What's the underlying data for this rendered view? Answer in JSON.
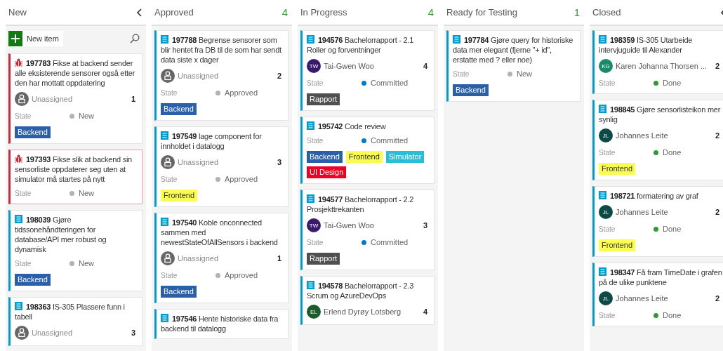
{
  "columns": [
    {
      "title": "New",
      "collapsible": true,
      "new_item": {
        "label": "New item"
      },
      "cards": [
        {
          "kind": "bug",
          "id": "197783",
          "title": "Fikse at backend sender alle eksisterende sensorer også etter den har mottatt oppdatering",
          "selected": false,
          "assignee": {
            "kind": "unassigned",
            "name": "Unassigned"
          },
          "effort": "1",
          "state_label": "State",
          "state": {
            "name": "New",
            "color": "#b2b2b2"
          },
          "tags": [
            {
              "label": "Backend",
              "color": "#2b5fa8"
            }
          ]
        },
        {
          "kind": "bug",
          "id": "197393",
          "title": "Fikse slik at backend sin sensorliste oppdaterer seg uten at simulator må startes på nytt",
          "selected": true,
          "state_label": "State",
          "state": {
            "name": "New",
            "color": "#b2b2b2"
          }
        },
        {
          "kind": "story",
          "id": "198039",
          "title": "Gjøre tidssonehåndteringen for database/API mer robust og dynamisk",
          "selected": false,
          "state_label": "State",
          "state": {
            "name": "New",
            "color": "#b2b2b2"
          },
          "tags": [
            {
              "label": "Backend",
              "color": "#2b5fa8"
            }
          ]
        },
        {
          "kind": "story",
          "id": "198363",
          "title": "IS-305 Plassere funn i tabell",
          "selected": false,
          "assignee": {
            "kind": "unassigned",
            "name": "Unassigned"
          },
          "effort": "3"
        }
      ]
    },
    {
      "title": "Approved",
      "count": "4",
      "cards": [
        {
          "kind": "story",
          "id": "197788",
          "title": "Begrense sensorer som blir hentet fra DB til de som har sendt data siste x dager",
          "selected": false,
          "assignee": {
            "kind": "unassigned",
            "name": "Unassigned"
          },
          "effort": "2",
          "state_label": "State",
          "state": {
            "name": "Approved",
            "color": "#b2b2b2"
          },
          "tags": [
            {
              "label": "Backend",
              "color": "#2b5fa8"
            }
          ]
        },
        {
          "kind": "story",
          "id": "197549",
          "title": "lage component for innholdet i datalogg",
          "selected": false,
          "assignee": {
            "kind": "unassigned",
            "name": "Unassigned"
          },
          "effort": "3",
          "state_label": "State",
          "state": {
            "name": "Approved",
            "color": "#b2b2b2"
          },
          "tags": [
            {
              "label": "Frontend",
              "color": "#fbfd52"
            }
          ]
        },
        {
          "kind": "story",
          "id": "197540",
          "title": "Koble onconnected sammen med newestStateOfAllSensors i backend",
          "selected": false,
          "assignee": {
            "kind": "unassigned",
            "name": "Unassigned"
          },
          "effort": "1",
          "state_label": "State",
          "state": {
            "name": "Approved",
            "color": "#b2b2b2"
          },
          "tags": [
            {
              "label": "Backend",
              "color": "#2b5fa8"
            }
          ]
        },
        {
          "kind": "story",
          "id": "197546",
          "title": "Hente historiske data fra backend til datalogg",
          "selected": false
        }
      ]
    },
    {
      "title": "In Progress",
      "count": "4",
      "cards": [
        {
          "kind": "story",
          "id": "194576",
          "title": "Bachelorrapport - 2.1 Roller og forventninger",
          "selected": false,
          "assignee": {
            "kind": "person",
            "name": "Tai-Gwen Woo",
            "initials": "TW",
            "color": "#3a1a6a"
          },
          "effort": "4",
          "state_label": "State",
          "state": {
            "name": "Committed",
            "color": "#007acc"
          },
          "tags": [
            {
              "label": "Rapport",
              "color": "#505050"
            }
          ]
        },
        {
          "kind": "story",
          "id": "195742",
          "title": "Code review",
          "selected": false,
          "state_label": "State",
          "state": {
            "name": "Committed",
            "color": "#007acc"
          },
          "tags": [
            {
              "label": "Backend",
              "color": "#2b5fa8"
            },
            {
              "label": "Frontend",
              "color": "#fbfd52"
            },
            {
              "label": "Simulator",
              "color": "#2bbcd8"
            },
            {
              "label": "UI Design",
              "color": "#ec0023"
            }
          ]
        },
        {
          "kind": "story",
          "id": "194577",
          "title": "Bachelorrapport - 2.2 Prosjekttrekanten",
          "selected": false,
          "assignee": {
            "kind": "person",
            "name": "Tai-Gwen Woo",
            "initials": "TW",
            "color": "#3a1a6a"
          },
          "effort": "3",
          "state_label": "State",
          "state": {
            "name": "Committed",
            "color": "#007acc"
          },
          "tags": [
            {
              "label": "Rapport",
              "color": "#505050"
            }
          ]
        },
        {
          "kind": "story",
          "id": "194578",
          "title": "Bachelorrapport - 2.3 Scrum og AzureDevOps",
          "selected": false,
          "assignee": {
            "kind": "person",
            "name": "Erlend Dyrøy Lotsberg",
            "initials": "EL",
            "color": "#1d5a2c"
          },
          "effort": "4"
        }
      ]
    },
    {
      "title": "Ready for Testing",
      "count": "1",
      "cards": [
        {
          "kind": "story",
          "id": "197784",
          "title": "Gjøre query for historiske data mer elegant (fjerne \"+ id\", erstatte med ? eller noe)",
          "selected": false,
          "state_label": "State",
          "state": {
            "name": "New",
            "color": "#b2b2b2"
          },
          "tags": [
            {
              "label": "Backend",
              "color": "#2b5fa8"
            }
          ]
        }
      ]
    },
    {
      "title": "Closed",
      "collapsible": true,
      "cards": [
        {
          "kind": "story",
          "id": "198359",
          "title": "IS-305 Utarbeide intervjuguide til Alexander",
          "selected": false,
          "assignee": {
            "kind": "person",
            "name": "Karen Johanna Thorsen ...",
            "initials": "KG",
            "color": "#1b8a6b"
          },
          "effort": "2",
          "state_label": "State",
          "state": {
            "name": "Done",
            "color": "#339933"
          }
        },
        {
          "kind": "story",
          "id": "198845",
          "title": "Gjøre sensorlisteikon mer synlig",
          "selected": false,
          "assignee": {
            "kind": "person",
            "name": "Johannes Leite",
            "initials": "JL",
            "color": "#0d4a46"
          },
          "effort": "2",
          "state_label": "State",
          "state": {
            "name": "Done",
            "color": "#339933"
          },
          "tags": [
            {
              "label": "Frontend",
              "color": "#fbfd52"
            }
          ]
        },
        {
          "kind": "story",
          "id": "198721",
          "title": "formatering av graf",
          "selected": false,
          "assignee": {
            "kind": "person",
            "name": "Johannes Leite",
            "initials": "JL",
            "color": "#0d4a46"
          },
          "effort": "2",
          "state_label": "State",
          "state": {
            "name": "Done",
            "color": "#339933"
          },
          "tags": [
            {
              "label": "Frontend",
              "color": "#fbfd52"
            }
          ]
        },
        {
          "kind": "story",
          "id": "198347",
          "title": "Få fram TimeDate i grafen på de ulike punktene",
          "selected": false,
          "assignee": {
            "kind": "person",
            "name": "Johannes Leite",
            "initials": "JL",
            "color": "#0d4a46"
          },
          "effort": "2",
          "state_label": "State",
          "state": {
            "name": "Done",
            "color": "#339933"
          }
        }
      ]
    }
  ]
}
